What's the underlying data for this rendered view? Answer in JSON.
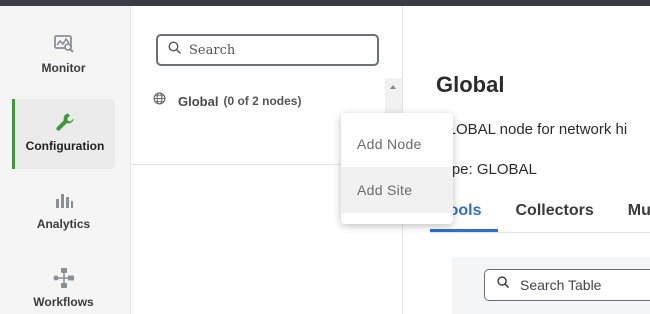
{
  "sidebar": {
    "items": [
      {
        "label": "Monitor",
        "icon": "monitor-icon",
        "active": false
      },
      {
        "label": "Configuration",
        "icon": "wrench-icon",
        "active": true
      },
      {
        "label": "Analytics",
        "icon": "bar-chart-icon",
        "active": false
      },
      {
        "label": "Workflows",
        "icon": "workflow-icon",
        "active": false
      }
    ],
    "accent_color": "#3d9a3a"
  },
  "tree": {
    "search_placeholder": "Search",
    "node_name": "Global",
    "node_count": "(0 of 2 nodes)"
  },
  "context_menu": {
    "items": [
      {
        "label": "Add Node"
      },
      {
        "label": "Add Site"
      }
    ]
  },
  "main": {
    "title": "Global",
    "description": "GLOBAL node for network hi",
    "type_line": "Type: GLOBAL",
    "tabs": [
      {
        "label": "Tools",
        "active": true
      },
      {
        "label": "Collectors",
        "active": false
      },
      {
        "label": "Mult",
        "active": false
      }
    ],
    "table_search_placeholder": "Search Table"
  },
  "colors": {
    "tab_active": "#2e6fc9"
  }
}
